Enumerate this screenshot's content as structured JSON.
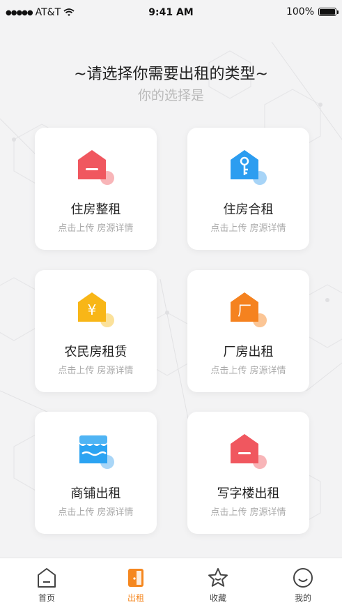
{
  "status_bar": {
    "signal": "●●●●●",
    "carrier": "AT&T",
    "time": "9:41 AM",
    "battery": "100%"
  },
  "header": {
    "title": "~请选择你需要出租的类型~",
    "subtitle": "你的选择是"
  },
  "cards": [
    {
      "title": "住房整租",
      "desc": "点击上传 房源详情",
      "icon": "house-minus-icon",
      "color": "#f0575f"
    },
    {
      "title": "住房合租",
      "desc": "点击上传 房源详情",
      "icon": "house-key-icon",
      "color": "#2c9df0"
    },
    {
      "title": "农民房租赁",
      "desc": "点击上传 房源详情",
      "icon": "house-yen-icon",
      "color": "#f8b617"
    },
    {
      "title": "厂房出租",
      "desc": "点击上传 房源详情",
      "icon": "house-factory-icon",
      "color": "#f5821f"
    },
    {
      "title": "商铺出租",
      "desc": "点击上传 房源详情",
      "icon": "shop-awning-icon",
      "color": "#2ba3f2"
    },
    {
      "title": "写字楼出租",
      "desc": "点击上传 房源详情",
      "icon": "house-minus-icon",
      "color": "#f0575f"
    }
  ],
  "icon_glyphs": {
    "yen": "¥",
    "factory": "厂"
  },
  "tabbar": {
    "active_color": "#f5871f",
    "items": [
      {
        "label": "首页",
        "icon": "home-icon"
      },
      {
        "label": "出租",
        "icon": "door-icon"
      },
      {
        "label": "收藏",
        "icon": "star-icon"
      },
      {
        "label": "我的",
        "icon": "smile-icon"
      }
    ]
  }
}
